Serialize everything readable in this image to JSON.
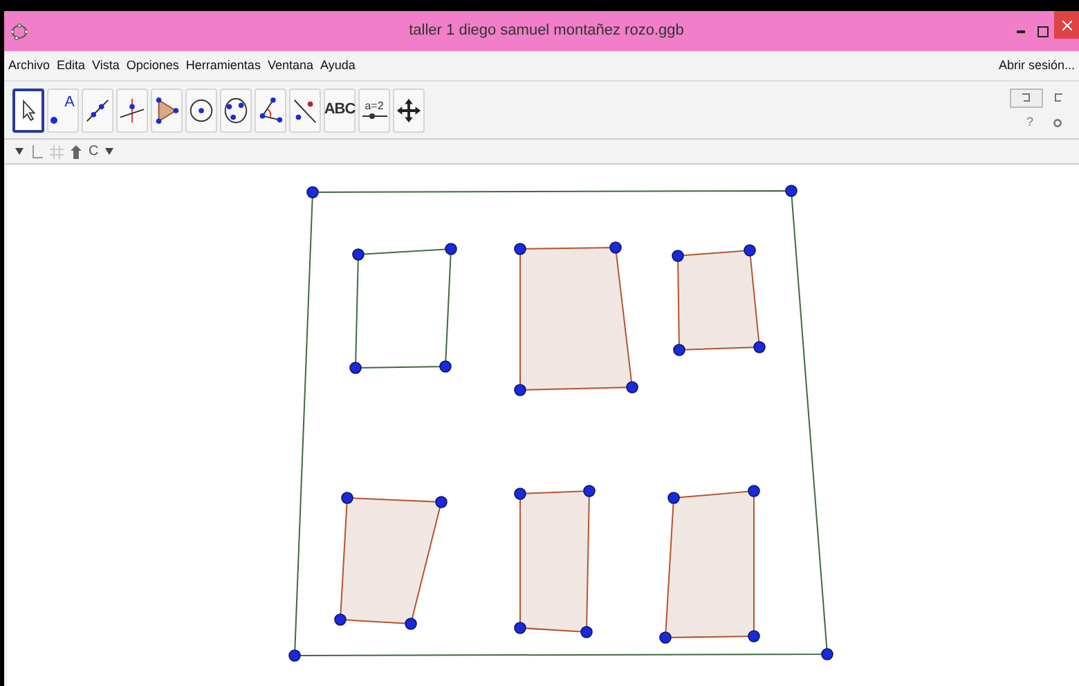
{
  "window": {
    "title": "taller 1 diego samuel montañez rozo.ggb"
  },
  "menu": [
    "Archivo",
    "Edita",
    "Vista",
    "Opciones",
    "Herramientas",
    "Ventana",
    "Ayuda"
  ],
  "sign_in": "Abrir sesión...",
  "tools": [
    {
      "kind": "move",
      "selected": true
    },
    {
      "kind": "point",
      "label": "A",
      "selected": false
    },
    {
      "kind": "line",
      "selected": false
    },
    {
      "kind": "perpendicular",
      "selected": false
    },
    {
      "kind": "polygon",
      "selected": false
    },
    {
      "kind": "circle",
      "selected": false
    },
    {
      "kind": "conic",
      "selected": false
    },
    {
      "kind": "angle",
      "selected": false
    },
    {
      "kind": "reflect",
      "selected": false
    },
    {
      "kind": "text",
      "label": "ABC",
      "selected": false
    },
    {
      "kind": "slider",
      "label": "a=2",
      "selected": false
    },
    {
      "kind": "pan",
      "selected": false
    }
  ],
  "style_bar": {
    "label": "C"
  },
  "right_tools": {
    "help": "?"
  },
  "shapes": [
    {
      "kind": "segments"
    },
    {
      "kind": "segments"
    },
    {
      "kind": "polygon"
    },
    {
      "kind": "polygon"
    },
    {
      "kind": "polygon"
    },
    {
      "kind": "polygon"
    },
    {
      "kind": "polygon"
    }
  ]
}
